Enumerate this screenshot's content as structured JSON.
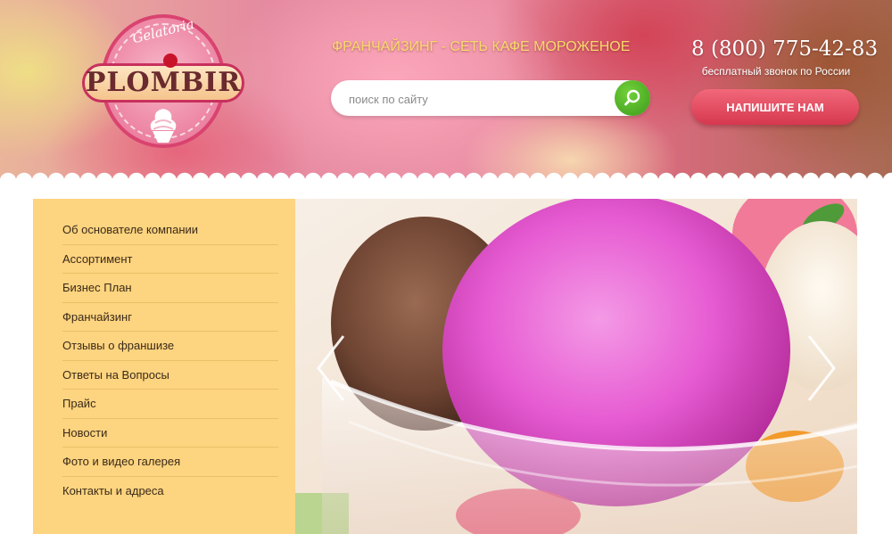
{
  "header": {
    "logo": {
      "script": "Gelatoria",
      "name": "PLOMBIR"
    },
    "title": "ФРАНЧАЙЗИНГ - СЕТЬ КАФЕ МОРОЖЕНОЕ",
    "search": {
      "placeholder": "поиск по сайту",
      "icon": "search-icon"
    },
    "phone": "8 (800) 775-42-83",
    "phone_note": "бесплатный звонок по России",
    "contact_button": "НАПИШИТЕ НАМ"
  },
  "sidebar": {
    "items": [
      {
        "label": "Об основателе компании"
      },
      {
        "label": "Ассортимент"
      },
      {
        "label": "Бизнес План"
      },
      {
        "label": "Франчайзинг"
      },
      {
        "label": "Отзывы о франшизе"
      },
      {
        "label": "Ответы на Вопросы"
      },
      {
        "label": "Прайс"
      },
      {
        "label": "Новости"
      },
      {
        "label": "Фото и видео галерея"
      },
      {
        "label": "Контакты и адреса"
      }
    ]
  },
  "slider": {
    "prev_icon": "chevron-left-icon",
    "next_icon": "chevron-right-icon"
  },
  "colors": {
    "accent": "#d6384f",
    "sidebar": "#fdd47f",
    "title": "#f7da6b",
    "search_button": "#4caf24"
  }
}
